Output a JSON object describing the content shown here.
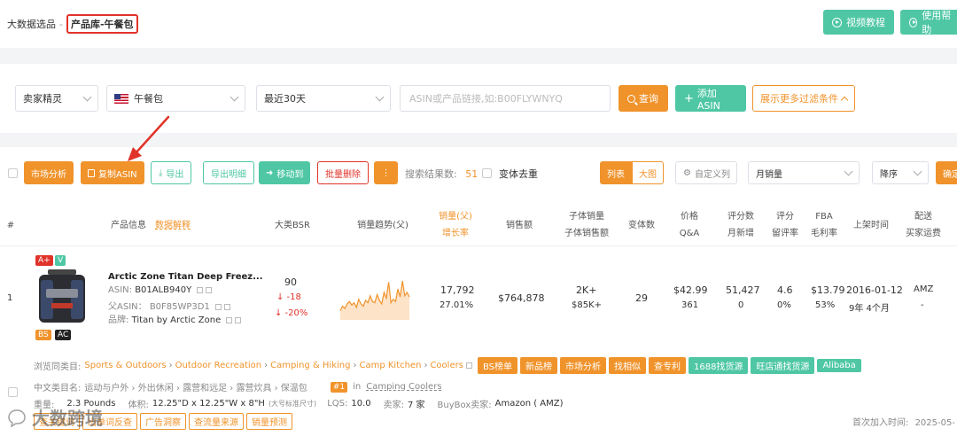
{
  "breadcrumb": {
    "root": "大数据选品",
    "sep": "-",
    "current": "产品库-午餐包"
  },
  "header": {
    "video_tutorial": "视频教程",
    "help": "使用帮助"
  },
  "filters": {
    "site_type": "卖家精灵",
    "category": "午餐包",
    "date_range": "最近30天",
    "asin_placeholder": "ASIN或产品链接,如:B00FLYWNYQ",
    "query_button": "查询",
    "add_asin_button": "添加ASIN",
    "more_filters_button": "展示更多过滤条件"
  },
  "toolbar": {
    "market_analysis": "市场分析",
    "copy_asin": "复制ASIN",
    "export": "导出",
    "export_detail": "导出明细",
    "move_to": "移动到",
    "batch_delete": "批量删除",
    "more": "⋮",
    "result_label": "搜索结果数:",
    "result_count": "51",
    "variant_dedupe": "变体去重",
    "view_list": "列表",
    "view_grid": "大图",
    "custom_columns": "自定义列",
    "sort_field": "月销量",
    "sort_order": "降序",
    "confirm": "确定"
  },
  "columns": {
    "index": "#",
    "product_info": "产品信息",
    "data_explain": "数据解释",
    "bsr": "大类BSR",
    "sales_trend": "销量趋势(父)",
    "sales_l1": "销量(父)",
    "sales_l2": "增长率",
    "revenue": "销售额",
    "child_sales_l1": "子体销量",
    "child_sales_l2": "子体销售额",
    "variants": "变体数",
    "price_l1": "价格",
    "price_l2": "Q&A",
    "rating_count_l1": "评分数",
    "rating_count_l2": "月新增",
    "rating_l1": "评分",
    "rating_l2": "留评率",
    "fba_l1": "FBA",
    "fba_l2": "毛利率",
    "listing_date": "上架时间",
    "delivery_l1": "配送",
    "delivery_l2": "买家运费"
  },
  "row": {
    "index": "1",
    "badge_aplus": "A+",
    "badge_v": "V",
    "badge_bs": "BS",
    "badge_ac": "AC",
    "title": "Arctic Zone Titan Deep Freez...",
    "asin_label": "ASIN:",
    "asin": "B01ALB940Y",
    "parent_asin_label": "父ASIN：",
    "parent_asin": "B0F85WP3D1",
    "brand_label": "品牌:",
    "brand": "Titan by Arctic Zone",
    "bsr": "90",
    "bsr_change": "↓ -18",
    "bsr_change_pct": "↓ -20%",
    "sales": "17,792",
    "growth": "27.01%",
    "revenue": "$764,878",
    "child_sales": "2K+",
    "child_revenue": "$85K+",
    "variants": "29",
    "price": "$42.99",
    "qa": "361",
    "rating_count": "51,427",
    "rating_new": "0",
    "rating": "4.6",
    "review_rate": "0%",
    "fba": "$13.79",
    "margin": "53%",
    "listing_date": "2016-01-12",
    "listing_age": "9年 4个月",
    "delivery": "AMZ",
    "shipping_fee": "-"
  },
  "sales_trend": [
    8,
    12,
    10,
    14,
    16,
    13,
    15,
    11,
    18,
    14,
    12,
    17,
    15,
    21,
    16,
    15,
    22,
    17,
    14,
    24,
    19,
    33,
    15,
    18,
    16,
    27,
    20,
    34,
    21,
    24,
    20
  ],
  "detail": {
    "browse_label": "浏览同类目:",
    "browse_path": [
      "Sports & Outdoors",
      "Outdoor Recreation",
      "Camping & Hiking",
      "Camp Kitchen",
      "Coolers"
    ],
    "browse_buttons": [
      "BS榜单",
      "新品榜",
      "市场分析",
      "找相似",
      "查专利",
      "1688找货源",
      "旺店通找货源",
      "Alibaba"
    ],
    "cn_category_label": "中文类目名:",
    "cn_category": "运动与户外 › 外出休闲 › 露营和远足 › 露营炊具 › 保温包",
    "rank_badge": "#1",
    "rank_in": "in",
    "rank_category": "Camping Coolers",
    "weight_label": "重量:",
    "weight": "2.3 Pounds",
    "volume_label": "体积:",
    "volume": "12.25\"D x 12.25\"W x 8\"H",
    "volume_note": "(大号标准尺寸)",
    "lqs_label": "LQS:",
    "lqs": "10.0",
    "sellers_label": "卖家:",
    "sellers": "7 家",
    "buybox_label": "BuyBox卖家:",
    "buybox": "Amazon ( AMZ)",
    "bottom_buttons": [
      "查关键词",
      "出单词反查",
      "广告洞察",
      "查流量来源",
      "销量预测"
    ],
    "first_added_label": "首次加入时间:",
    "first_added": "2025-05-"
  },
  "watermark": "大数跨境",
  "colors": {
    "orange": "#f0932b",
    "green": "#4fc7a4",
    "red": "#e0332a"
  }
}
